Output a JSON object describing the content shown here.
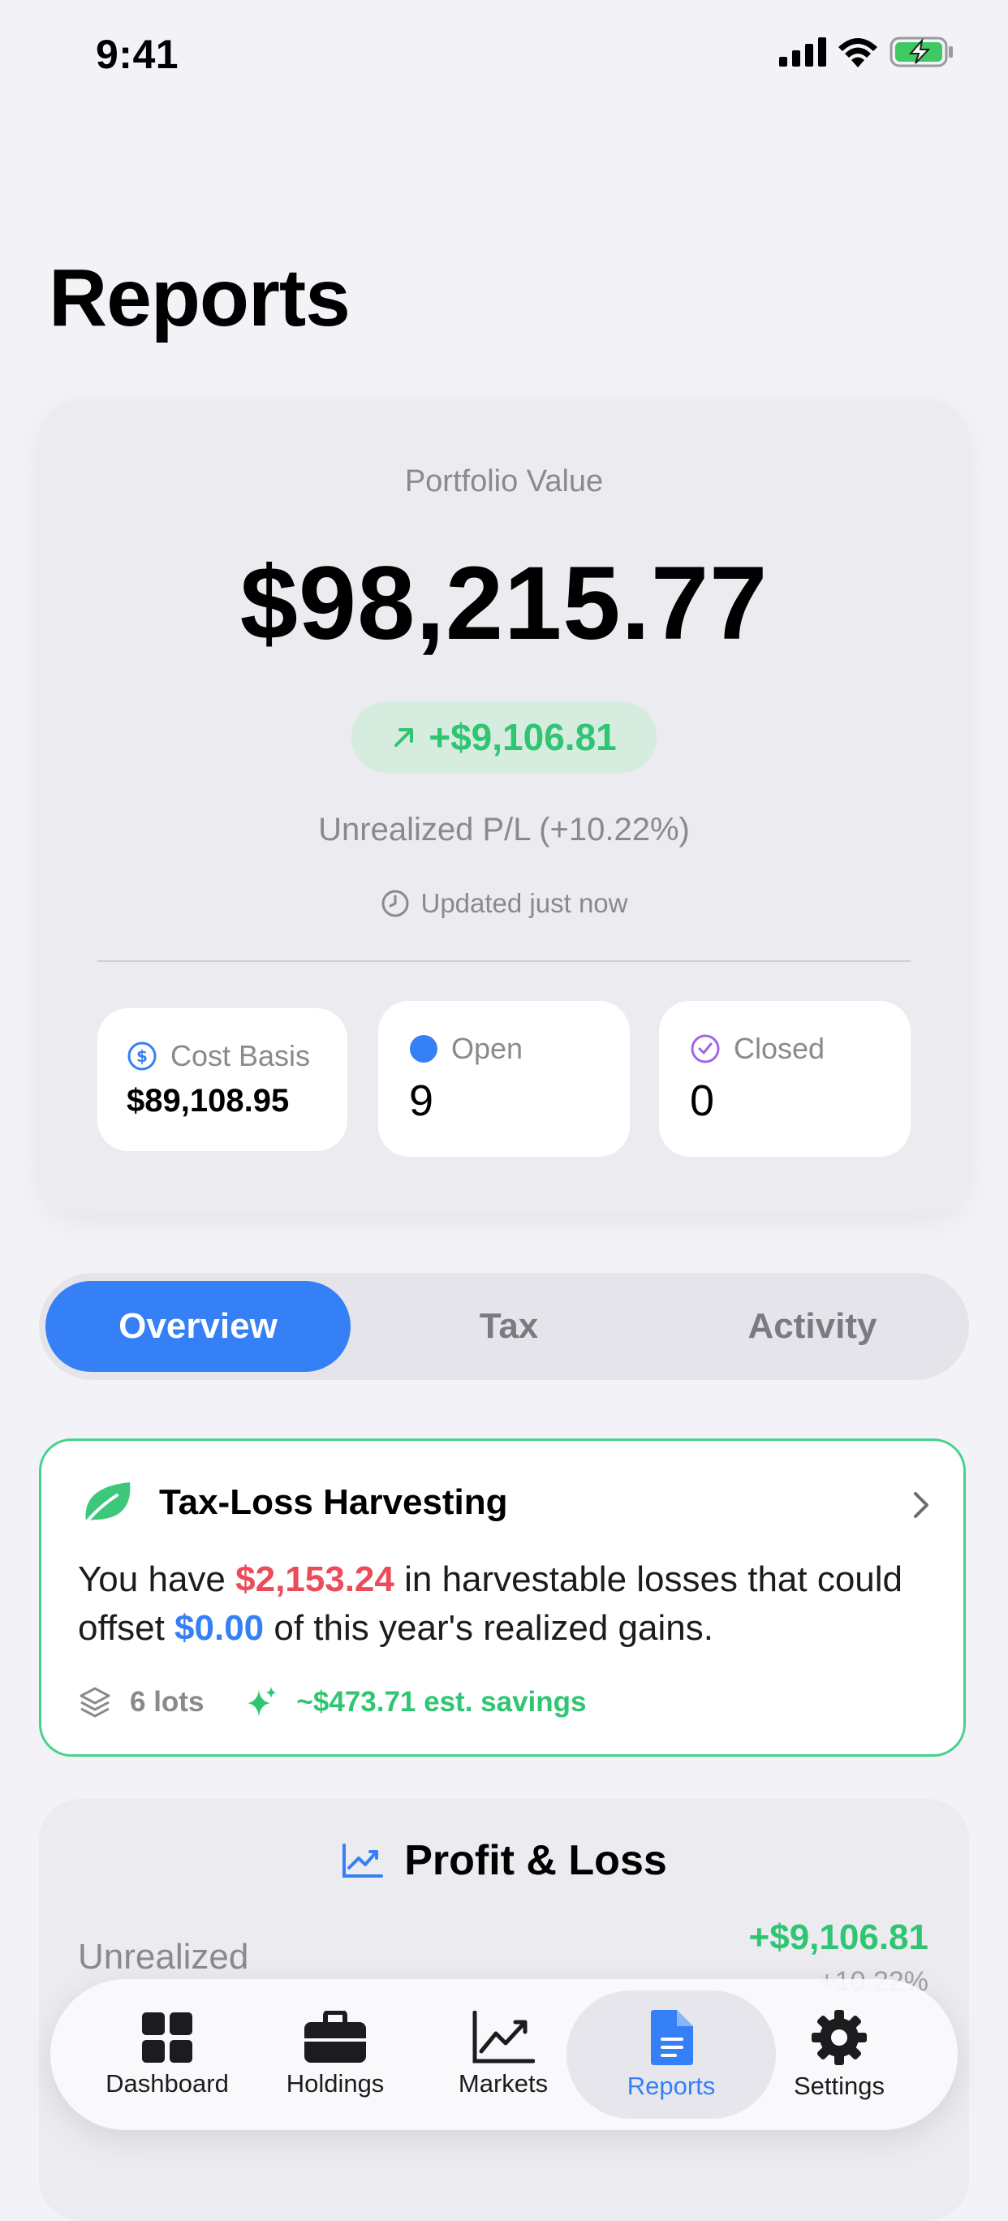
{
  "status": {
    "time": "9:41"
  },
  "header": {
    "title": "Reports"
  },
  "portfolio": {
    "label": "Portfolio Value",
    "value": "$98,215.77",
    "change": "+$9,106.81",
    "unrealized_label": "Unrealized P/L (+10.22%)",
    "updated": "Updated just now",
    "stats": [
      {
        "label": "Cost Basis",
        "value": "$89,108.95",
        "icon": "dollar-circle-icon",
        "color": "#3580f6"
      },
      {
        "label": "Open",
        "value": "9",
        "icon": "filled-circle-icon",
        "color": "#3580f6"
      },
      {
        "label": "Closed",
        "value": "0",
        "icon": "check-circle-icon",
        "color": "#a464e8"
      }
    ]
  },
  "segments": {
    "items": [
      "Overview",
      "Tax",
      "Activity"
    ],
    "selected": "Overview"
  },
  "tax_loss": {
    "title": "Tax-Loss Harvesting",
    "body_prefix": "You have ",
    "losses": "$2,153.24",
    "body_mid": " in harvestable losses that could offset ",
    "offset": "$0.00",
    "body_suffix": " of this year's realized gains.",
    "lots": "6 lots",
    "savings": "~$473.71 est. savings"
  },
  "profit_loss": {
    "title": "Profit & Loss",
    "unrealized_label": "Unrealized",
    "unrealized_value": "+$9,106.81",
    "unrealized_pct": "+10.22%"
  },
  "tabbar": {
    "items": [
      "Dashboard",
      "Holdings",
      "Markets",
      "Reports",
      "Settings"
    ],
    "selected": "Reports"
  },
  "colors": {
    "accent": "#3580f6",
    "positive": "#2fc572",
    "negative": "#ec4c5a",
    "harvest": "#48d18a"
  }
}
